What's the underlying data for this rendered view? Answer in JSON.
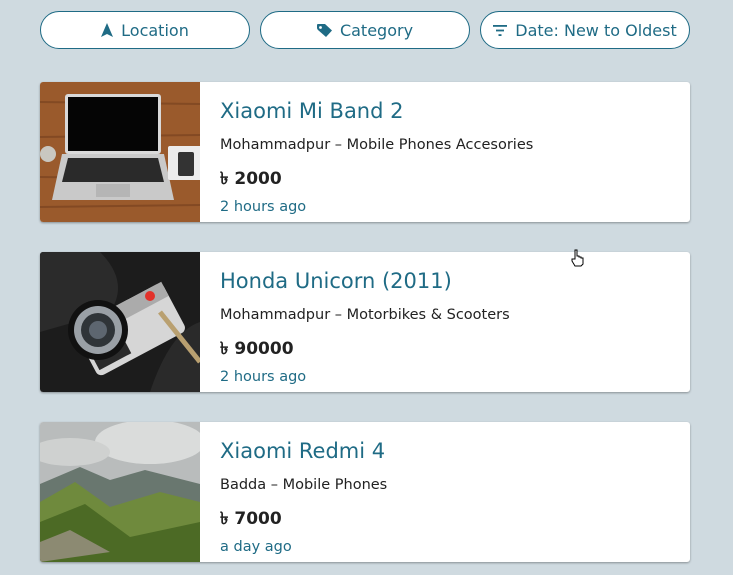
{
  "filters": {
    "location": {
      "label": "Location",
      "icon": "location-arrow-icon"
    },
    "category": {
      "label": "Category",
      "icon": "tag-icon"
    },
    "sort": {
      "label": "Date: New to Oldest",
      "icon": "filter-lines-icon"
    }
  },
  "colors": {
    "accent": "#1f6b85",
    "background": "#cfdae0"
  },
  "listings": [
    {
      "title": "Xiaomi Mi Band 2",
      "subtitle": "Mohammadpur – Mobile Phones Accesories",
      "price": "৳ 2000",
      "time": "2 hours ago",
      "image": "laptop-photo"
    },
    {
      "title": "Honda Unicorn (2011)",
      "subtitle": "Mohammadpur – Motorbikes & Scooters",
      "price": "৳ 90000",
      "time": "2 hours ago",
      "image": "camera-photo"
    },
    {
      "title": "Xiaomi Redmi 4",
      "subtitle": "Badda – Mobile Phones",
      "price": "৳ 7000",
      "time": "a day ago",
      "image": "mountain-landscape-photo"
    }
  ]
}
